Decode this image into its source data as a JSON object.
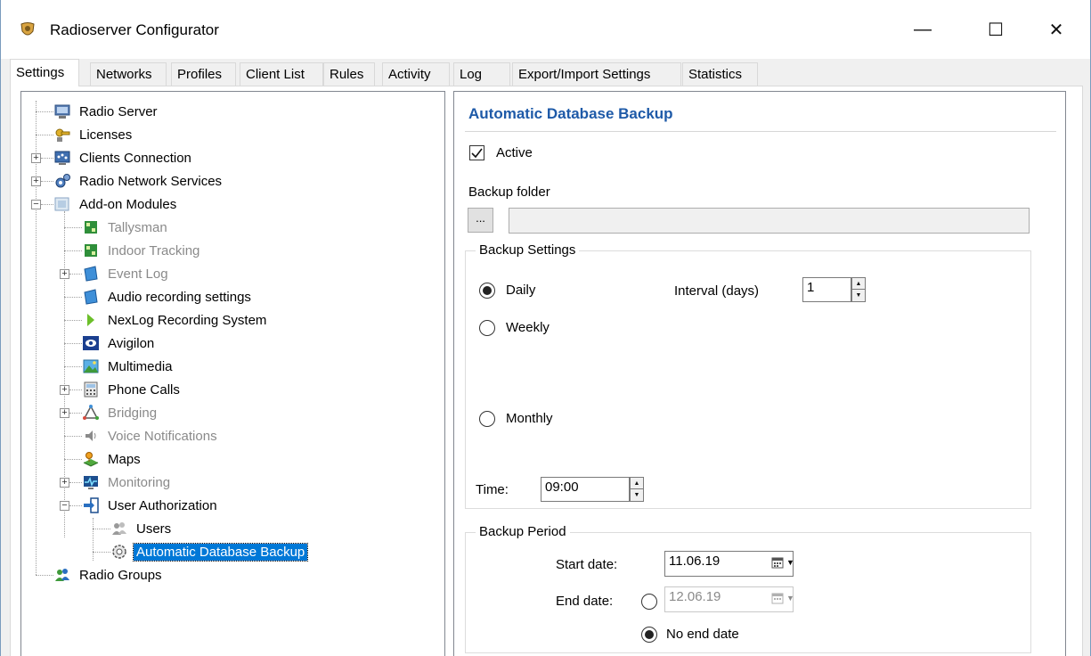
{
  "window": {
    "title": "Radioserver Configurator",
    "minimize_glyph": "—",
    "maximize_glyph": "☐",
    "close_glyph": "✕",
    "app_icon": "radio-shield-icon"
  },
  "tabs": [
    {
      "label": "Settings",
      "active": true
    },
    {
      "label": "Networks"
    },
    {
      "label": "Profiles"
    },
    {
      "label": "Client List"
    },
    {
      "label": "Rules"
    },
    {
      "label": "Activity"
    },
    {
      "label": "Log"
    },
    {
      "label": "Export/Import Settings"
    },
    {
      "label": "Statistics"
    }
  ],
  "tree": {
    "items": [
      {
        "label": "Radio Server",
        "icon": "server-icon"
      },
      {
        "label": "Licenses",
        "icon": "key-icon"
      },
      {
        "label": "Clients Connection",
        "icon": "network-icon"
      },
      {
        "label": "Radio Network Services",
        "icon": "gears-icon"
      },
      {
        "label": "Add-on Modules",
        "icon": "modules-icon"
      },
      {
        "label": "Tallysman",
        "icon": "module-green-icon",
        "disabled": true
      },
      {
        "label": "Indoor Tracking",
        "icon": "module-green-icon",
        "disabled": true
      },
      {
        "label": "Event Log",
        "icon": "module-blue-icon",
        "disabled": true
      },
      {
        "label": "Audio recording settings",
        "icon": "module-blue-icon"
      },
      {
        "label": "NexLog Recording System",
        "icon": "arrow-green-icon"
      },
      {
        "label": "Avigilon",
        "icon": "eye-icon"
      },
      {
        "label": "Multimedia",
        "icon": "picture-icon"
      },
      {
        "label": "Phone Calls",
        "icon": "phone-icon"
      },
      {
        "label": "Bridging",
        "icon": "bridge-icon",
        "disabled": true
      },
      {
        "label": "Voice Notifications",
        "icon": "speaker-icon",
        "disabled": true
      },
      {
        "label": "Maps",
        "icon": "map-icon"
      },
      {
        "label": "Monitoring",
        "icon": "monitor-icon",
        "disabled": true
      },
      {
        "label": "User Authorization",
        "icon": "login-arrow-icon"
      },
      {
        "label": "Users",
        "icon": "users-icon"
      },
      {
        "label": "Automatic Database Backup",
        "icon": "gear-backup-icon",
        "selected": true
      },
      {
        "label": "Radio Groups",
        "icon": "groups-icon"
      }
    ]
  },
  "backup": {
    "title": "Automatic Database Backup",
    "active_label": "Active",
    "active_checked": true,
    "folder_label": "Backup folder",
    "browse_label": "...",
    "folder_value": "",
    "settings_caption": "Backup Settings",
    "daily_label": "Daily",
    "weekly_label": "Weekly",
    "monthly_label": "Monthly",
    "frequency_selected": "Daily",
    "interval_label": "Interval (days)",
    "interval_value": "1",
    "time_label": "Time:",
    "time_value": "09:00",
    "period_caption": "Backup Period",
    "start_label": "Start date:",
    "start_value": "11.06.19",
    "end_label": "End date:",
    "end_value": "12.06.19",
    "no_end_label": "No end date",
    "end_choice": "No end date"
  }
}
